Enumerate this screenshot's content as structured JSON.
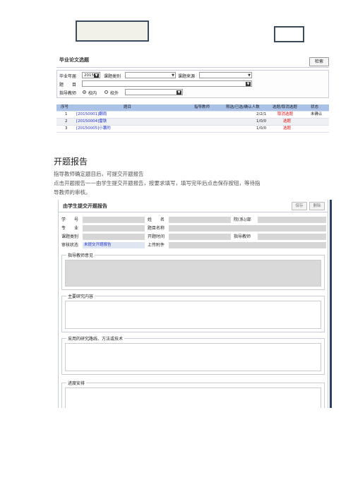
{
  "list_panel": {
    "title": "毕业论文选题",
    "search_button": "检索",
    "filter": {
      "year_label": "毕业年届",
      "year_value": "2015",
      "category_label": "课题类别",
      "source_label": "课题来源",
      "topic_label": "题　　目",
      "advisor_label": "指导教师",
      "radio_inside": "校内",
      "radio_outside": "校外"
    },
    "table": {
      "headers": [
        "序号",
        "题目",
        "指导教师",
        "限选/已选/确认人数",
        "选题/取消选题",
        "状态"
      ],
      "rows": [
        {
          "no": "1",
          "topic": "[20150001]翻雨",
          "advisor": "",
          "count": "2/2/1",
          "action": "取消选题",
          "status": "未确认"
        },
        {
          "no": "2",
          "topic": "[20150004]雷铁",
          "advisor": "",
          "count": "1/0/0",
          "action": "选题",
          "status": ""
        },
        {
          "no": "3",
          "topic": "[20150005]小薯的",
          "advisor": "",
          "count": "1/0/0",
          "action": "选题",
          "status": ""
        }
      ]
    }
  },
  "section_heading": "开题报告",
  "paragraphs": [
    "指导教师确定题目后，可提交开题报告",
    "点击开题报告一一由学生提交开题报告，按要求填写，填写完毕后点击保存按钮，等待指",
    "导教师的审核。"
  ],
  "form_panel": {
    "title": "由学生提交开题报告",
    "save_button": "保存",
    "delete_button": "删除",
    "labels": {
      "student_no": "学　　号",
      "name": "姓　　名",
      "department": "院(系)/部",
      "major": "专　　业",
      "topic_name": "题目名称",
      "topic_type": "课题类别",
      "open_time": "开题时间",
      "advisor": "指导教师",
      "review_status": "审核状态",
      "attachment": "上传附件"
    },
    "review_status_value": "未提交开题报告",
    "sections": [
      "指导教师意见",
      "主要研究内容",
      "采用的研究路线、方法或技术",
      "进度安排"
    ]
  },
  "colors": {
    "table_header": "#a9c2e6",
    "link_blue": "#2233cc",
    "action_red": "#dd1111",
    "scrollbar": "#2a3f66"
  }
}
